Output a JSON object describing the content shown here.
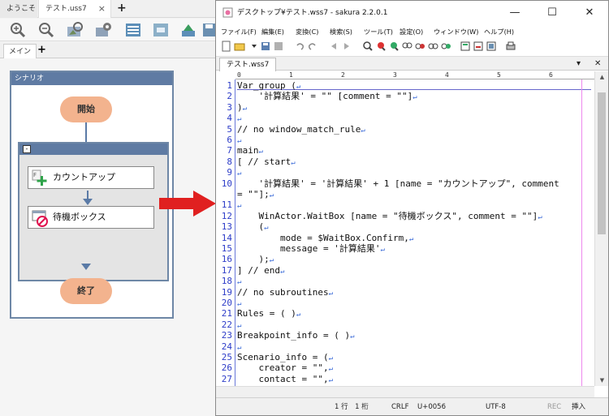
{
  "left_app": {
    "tabs": [
      {
        "label": "ようこそ"
      },
      {
        "label": "テスト.uss7",
        "close": "×"
      }
    ],
    "add_tab": "+",
    "toolbar_icons": [
      "zoom-in-icon",
      "zoom-out-icon",
      "image-search-icon",
      "settings-icon",
      "table-icon",
      "export-icon",
      "import-icon",
      "save-icon"
    ],
    "subtab": "メイン",
    "subtab_add": "+",
    "scenario": {
      "title": "シナリオ",
      "start": "開始",
      "end": "終了",
      "group_toggle": "-",
      "nodes": [
        {
          "label": "カウントアップ",
          "icon": "counter-plus-icon"
        },
        {
          "label": "待機ボックス",
          "icon": "wait-box-icon"
        }
      ]
    },
    "colors": {
      "node_oval": "#f3b38e",
      "header": "#5f7ba3",
      "arrow": "#e02020"
    }
  },
  "editor_window": {
    "title": "デスクトップ¥テスト.wss7 - sakura 2.2.0.1",
    "window_buttons": {
      "minimize": "—",
      "maximize": "☐",
      "close": "✕"
    },
    "menu": [
      "ファイル(F)",
      "編集(E)",
      "変換(C)",
      "検索(S)",
      "ツール(T)",
      "設定(O)",
      "ウィンドウ(W)",
      "ヘルプ(H)"
    ],
    "file_tab": "テスト.wss7",
    "file_tab_controls": {
      "dropdown": "▾",
      "close": "✕"
    },
    "ruler_ticks": [
      "0",
      "1",
      "2",
      "3",
      "4",
      "5",
      "6"
    ],
    "line_numbers": [
      "1",
      "2",
      "3",
      "4",
      "5",
      "6",
      "7",
      "8",
      "9",
      "10",
      "11",
      "12",
      "13",
      "14",
      "15",
      "16",
      "17",
      "18",
      "19",
      "20",
      "21",
      "22",
      "23",
      "24",
      "25",
      "26",
      "27"
    ],
    "code_lines": [
      "Var_group (",
      "    '計算結果' = \"\" [comment = \"\"]",
      ")",
      "",
      "// no window_match_rule",
      "",
      "main",
      "[ // start",
      "",
      "    '計算結果' = '計算結果' + 1 [name = \"カウントアップ\", comment",
      "= \"\"];",
      "",
      "    WinActor.WaitBox [name = \"待機ボックス\", comment = \"\"]",
      "    (",
      "        mode = $WaitBox.Confirm,",
      "        message = '計算結果'",
      "    );",
      "] // end",
      "",
      "// no subroutines",
      "",
      "Rules = ( )",
      "",
      "Breakpoint_info = ( )",
      "",
      "Scenario_info = (",
      "    creator = \"\",",
      "    contact = \"\","
    ],
    "status": {
      "position": "1 行　1 桁",
      "eol": "CRLF",
      "char_code": "U+0056",
      "encoding": "UTF-8",
      "rec": "REC",
      "mode": "挿入"
    }
  }
}
